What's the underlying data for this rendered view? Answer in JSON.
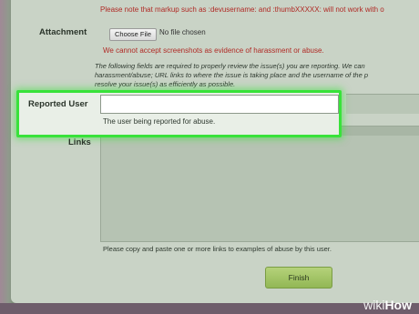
{
  "notice_markup": "Please note that markup such as :devusername: and :thumbXXXXX: will not work with o",
  "attachment": {
    "label": "Attachment",
    "choose_button": "Choose File",
    "file_status": "No file chosen",
    "warning": "We cannot accept screenshots as evidence of harassment or abuse."
  },
  "required_notice": {
    "line1": "The following fields are required to properly review the issue(s) you are reporting. We can",
    "line2": "harassment/abuse; URL links to where the issue is taking place and the username of the p",
    "line3": "resolve your issue(s) as efficiently as possible."
  },
  "reported_user": {
    "label": "Reported User",
    "value": "",
    "help": "The user being reported for abuse."
  },
  "links": {
    "label": "Links",
    "value": "",
    "help": "Please copy and paste one or more links to examples of abuse by this user."
  },
  "finish_button": "Finish",
  "watermark": {
    "wiki": "wiki",
    "how": "How"
  },
  "colors": {
    "highlight": "#38e23a",
    "finish_button": "#a3c466",
    "warning_text": "#b02a25"
  }
}
